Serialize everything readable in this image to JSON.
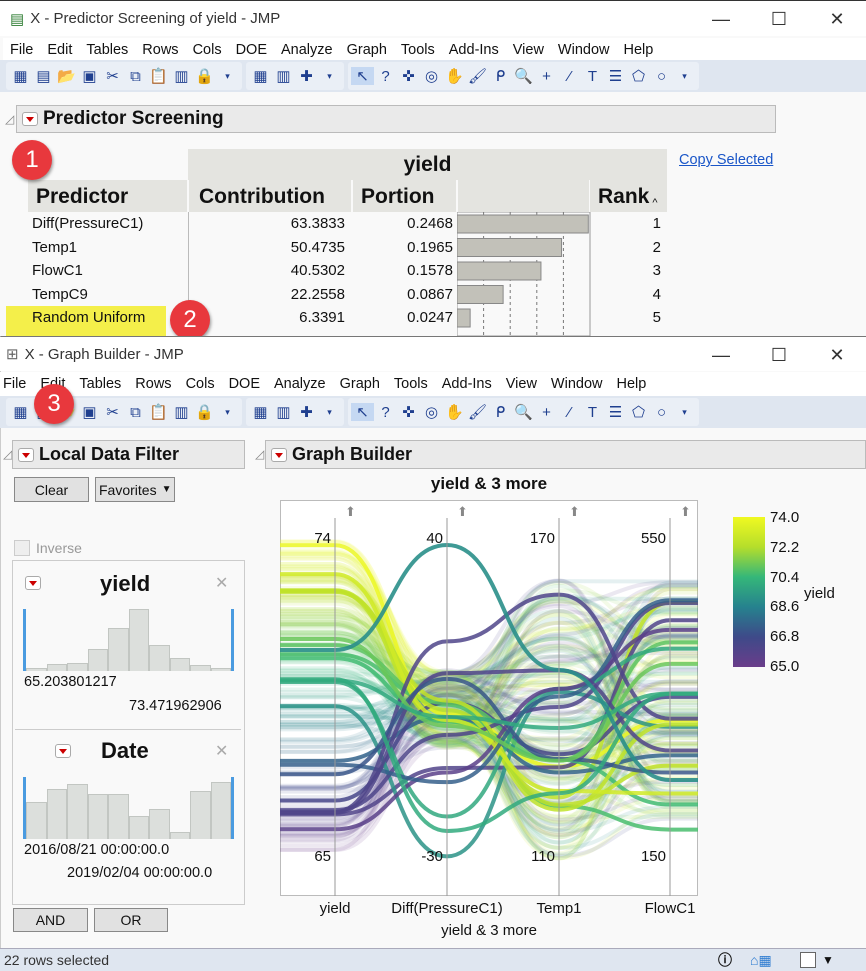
{
  "window1": {
    "title": "X - Predictor Screening of yield - JMP",
    "menu": [
      "File",
      "Edit",
      "Tables",
      "Rows",
      "Cols",
      "DOE",
      "Analyze",
      "Graph",
      "Tools",
      "Add-Ins",
      "View",
      "Window",
      "Help"
    ],
    "outline_title": "Predictor Screening",
    "copy_selected": "Copy Selected",
    "table": {
      "group_header": "yield",
      "columns": [
        "Predictor",
        "Contribution",
        "Portion",
        "",
        "Rank"
      ],
      "rows": [
        {
          "predictor": "Diff(PressureC1)",
          "contribution": "63.3833",
          "portion": "0.2468",
          "portion_value": 0.2468,
          "rank": "1"
        },
        {
          "predictor": "Temp1",
          "contribution": "50.4735",
          "portion": "0.1965",
          "portion_value": 0.1965,
          "rank": "2"
        },
        {
          "predictor": "FlowC1",
          "contribution": "40.5302",
          "portion": "0.1578",
          "portion_value": 0.1578,
          "rank": "3"
        },
        {
          "predictor": "TempC9",
          "contribution": "22.2558",
          "portion": "0.0867",
          "portion_value": 0.0867,
          "rank": "4"
        },
        {
          "predictor": "Random Uniform",
          "contribution": "6.3391",
          "portion": "0.0247",
          "portion_value": 0.0247,
          "rank": "5"
        }
      ]
    }
  },
  "badges": [
    "1",
    "2",
    "3"
  ],
  "window2": {
    "title": "X - Graph Builder - JMP",
    "menu": [
      "File",
      "Edit",
      "Tables",
      "Rows",
      "Cols",
      "DOE",
      "Analyze",
      "Graph",
      "Tools",
      "Add-Ins",
      "View",
      "Window",
      "Help"
    ],
    "filter": {
      "title": "Local Data Filter",
      "clear": "Clear",
      "favorites": "Favorites",
      "inverse": "Inverse",
      "yield": {
        "name": "yield",
        "min": "65.203801217",
        "max": "73.471962906",
        "hist": [
          0.05,
          0.12,
          0.13,
          0.35,
          0.7,
          1.0,
          0.42,
          0.21,
          0.1,
          0.05
        ]
      },
      "date": {
        "name": "Date",
        "min": "2016/08/21 00:00:00.0",
        "max": "2019/02/04 00:00:00.0",
        "hist": [
          0.6,
          0.8,
          0.88,
          0.73,
          0.73,
          0.37,
          0.48,
          0.12,
          0.77,
          0.92
        ]
      },
      "and": "AND",
      "or": "OR"
    },
    "graph": {
      "outline_title": "Graph Builder",
      "title": "yield & 3 more",
      "xlabel": "yield & 3 more",
      "axes": [
        {
          "name": "yield",
          "top": "74",
          "bottom": "65"
        },
        {
          "name": "Diff(PressureC1)",
          "top": "40",
          "bottom": "-30"
        },
        {
          "name": "Temp1",
          "top": "170",
          "bottom": "110"
        },
        {
          "name": "FlowC1",
          "top": "550",
          "bottom": "150"
        }
      ],
      "legend": {
        "title": "yield",
        "ticks": [
          "74.0",
          "72.2",
          "70.4",
          "68.6",
          "66.8",
          "65.0"
        ],
        "colors": [
          "#f0f921",
          "#b5de2b",
          "#35b779",
          "#26828e",
          "#3e4a89",
          "#6a3d8a"
        ]
      }
    },
    "status": "22 rows selected"
  }
}
